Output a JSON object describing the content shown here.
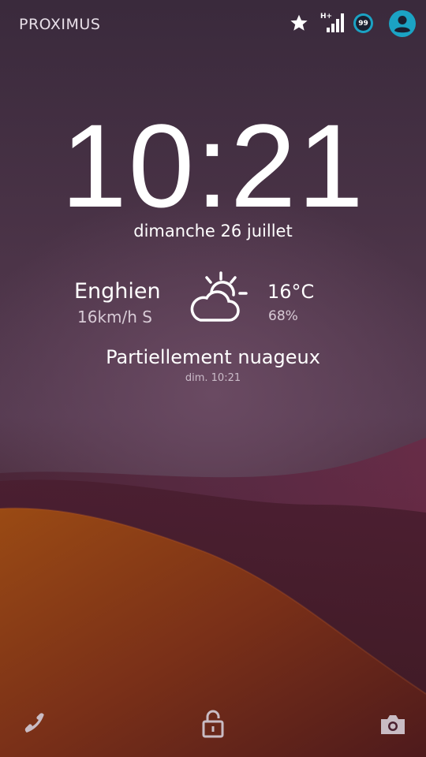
{
  "status_bar": {
    "carrier": "PROXIMUS",
    "icons": [
      "star-icon",
      "signal-hplus-icon",
      "notification-badge-icon",
      "user-account-icon"
    ],
    "network_type": "H+",
    "badge_count": "99",
    "accent_color": "#1ba3c4"
  },
  "lockscreen": {
    "time": "10:21",
    "date": "dimanche 26 juillet"
  },
  "weather": {
    "city": "Enghien",
    "wind": "16km/h S",
    "temperature": "16°C",
    "humidity": "68%",
    "condition": "Partiellement nuageux",
    "updated": "dim. 10:21",
    "icon": "partly-cloudy-icon"
  },
  "shortcuts": {
    "left": "phone-icon",
    "center": "unlock-icon",
    "right": "camera-icon"
  },
  "colors": {
    "wallpaper_top": "#3a2a3c",
    "wallpaper_wave": "#5a2a40",
    "wallpaper_bottom": "#8a3a1e"
  }
}
